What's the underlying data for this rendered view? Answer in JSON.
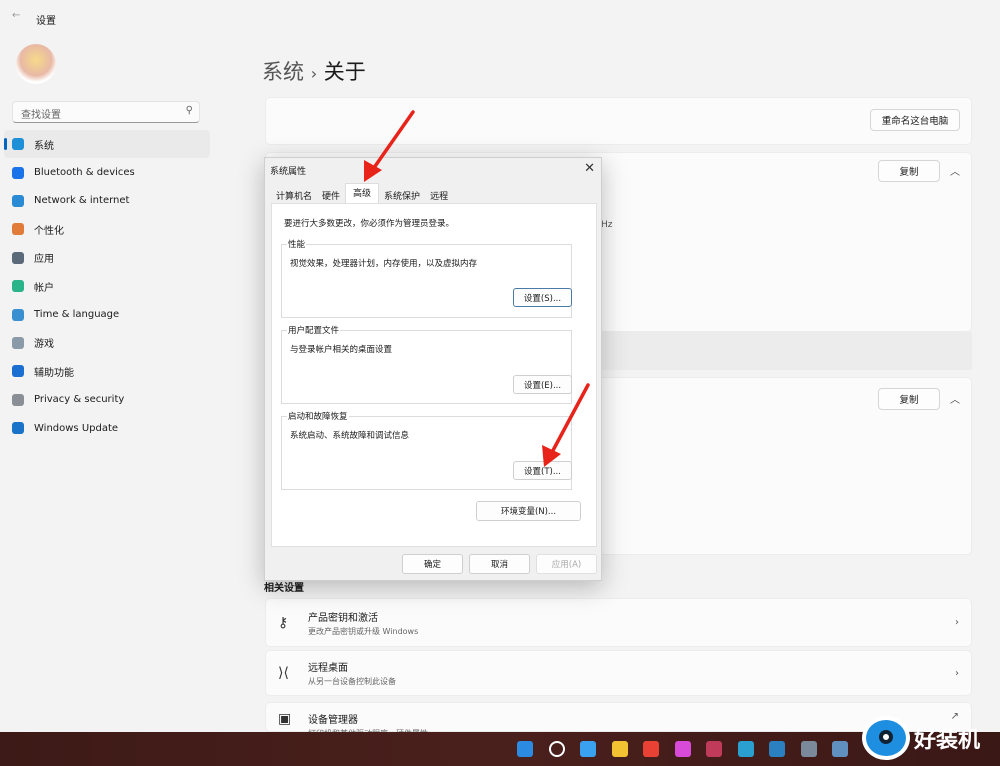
{
  "app": {
    "title": "设置",
    "back_icon": "arrow-left-icon"
  },
  "search": {
    "placeholder": "查找设置",
    "icon": "search-icon"
  },
  "sidebar": {
    "items": [
      {
        "label": "系统",
        "icon": "monitor-icon",
        "color": "#1e90d8",
        "active": true
      },
      {
        "label": "Bluetooth & devices",
        "icon": "bluetooth-icon",
        "color": "#1a73e8"
      },
      {
        "label": "Network & internet",
        "icon": "wifi-icon",
        "color": "#2a8ad4"
      },
      {
        "label": "个性化",
        "icon": "brush-icon",
        "color": "#e07b39"
      },
      {
        "label": "应用",
        "icon": "apps-icon",
        "color": "#5a6a7a"
      },
      {
        "label": "帐户",
        "icon": "person-icon",
        "color": "#2bb38a"
      },
      {
        "label": "Time & language",
        "icon": "globe-clock-icon",
        "color": "#3a8fd0"
      },
      {
        "label": "游戏",
        "icon": "gamepad-icon",
        "color": "#8a9aa8"
      },
      {
        "label": "辅助功能",
        "icon": "accessibility-icon",
        "color": "#1a6fd0"
      },
      {
        "label": "Privacy & security",
        "icon": "shield-icon",
        "color": "#8a8f96"
      },
      {
        "label": "Windows Update",
        "icon": "update-icon",
        "color": "#1a73c8"
      }
    ]
  },
  "breadcrumb": {
    "parent": "系统",
    "sep": "›",
    "current": "关于"
  },
  "main": {
    "rename_button": "重命名这台电脑",
    "copy_button_1": "复制",
    "copy_button_2": "复制",
    "hz_fragment": "Hz",
    "related_label": "相关设置",
    "related": [
      {
        "title": "产品密钥和激活",
        "subtitle": "更改产品密钥或升级 Windows",
        "icon": "key-icon",
        "trail": "›"
      },
      {
        "title": "远程桌面",
        "subtitle": "从另一台设备控制此设备",
        "icon": "remote-desktop-icon",
        "trail": "›"
      },
      {
        "title": "设备管理器",
        "subtitle": "打印机和其他驱动程序、硬件属性",
        "icon": "device-manager-icon",
        "trail": "↗"
      }
    ]
  },
  "dialog": {
    "title": "系统属性",
    "close": "✕",
    "tabs": [
      "计算机名",
      "硬件",
      "高级",
      "系统保护",
      "远程"
    ],
    "active_tab": "高级",
    "admin_note": "要进行大多数更改，你必须作为管理员登录。",
    "groups": [
      {
        "label": "性能",
        "desc": "视觉效果，处理器计划，内存使用，以及虚拟内存",
        "button": "设置(S)..."
      },
      {
        "label": "用户配置文件",
        "desc": "与登录帐户相关的桌面设置",
        "button": "设置(E)..."
      },
      {
        "label": "启动和故障恢复",
        "desc": "系统启动、系统故障和调试信息",
        "button": "设置(T)..."
      }
    ],
    "env_button": "环境变量(N)...",
    "ok": "确定",
    "cancel": "取消",
    "apply": "应用(A)"
  },
  "annotation_color": "#e8231a",
  "watermark": "好装机",
  "taskbar": {
    "icons": [
      "windows-start-icon",
      "search-icon",
      "task-view-icon",
      "file-explorer-icon",
      "chrome-icon",
      "color-app-icon",
      "office-icon",
      "edge-icon",
      "photos-icon",
      "settings-icon",
      "system-properties-icon"
    ]
  }
}
